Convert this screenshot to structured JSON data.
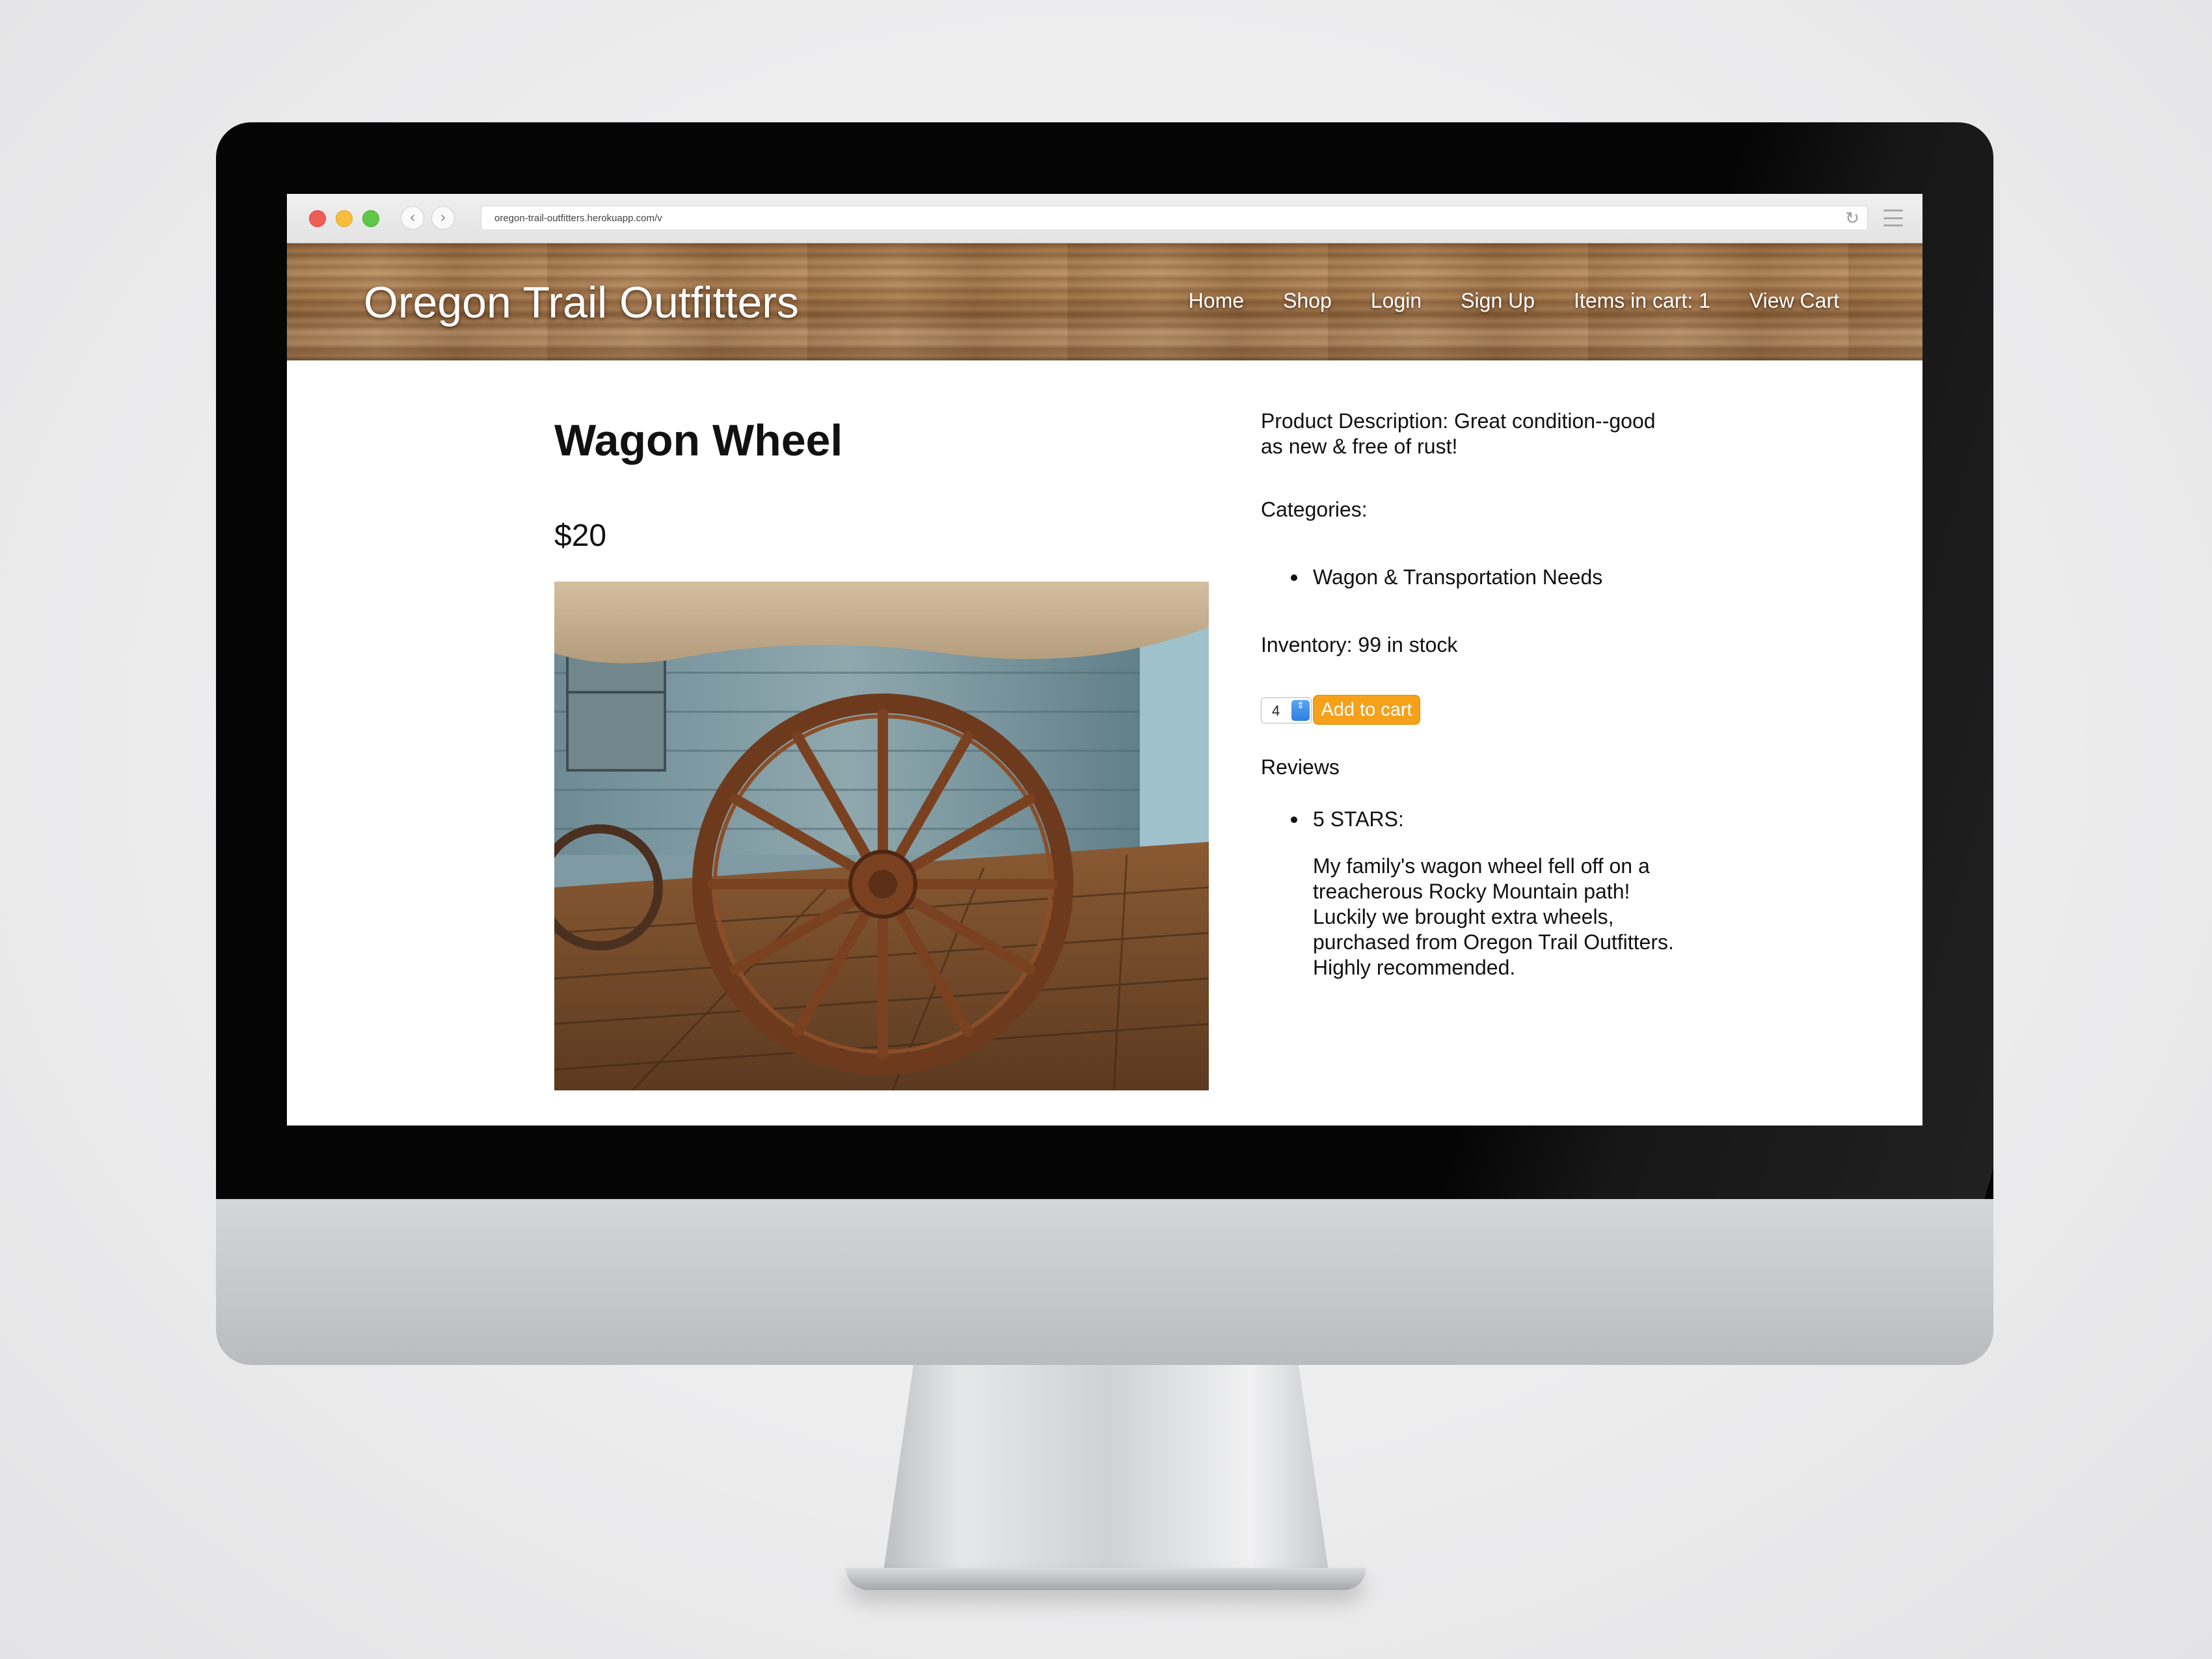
{
  "browser": {
    "url": "oregon-trail-outfitters.herokuapp.com/v",
    "back_icon": "‹",
    "forward_icon": "›",
    "reload_icon": "↻"
  },
  "site": {
    "title": "Oregon Trail Outfitters",
    "nav": {
      "home": "Home",
      "shop": "Shop",
      "login": "Login",
      "signup": "Sign Up",
      "cart_count": "Items in cart: 1",
      "view_cart": "View Cart"
    }
  },
  "product": {
    "name": "Wagon Wheel",
    "price": "$20",
    "description": "Product Description: Great condition--good as new & free of rust!",
    "categories_label": "Categories:",
    "categories": [
      "Wagon & Transportation Needs"
    ],
    "inventory": "Inventory: 99 in stock",
    "quantity": "4",
    "add_to_cart_label": "Add to cart",
    "reviews_label": "Reviews",
    "reviews": [
      {
        "rating": "5 STARS:",
        "text": "My family's wagon wheel fell off on a treacherous Rocky Mountain path! Luckily we brought extra wheels, purchased from Oregon Trail Outfitters. Highly recommended."
      }
    ]
  },
  "colors": {
    "accent_button": "#f5a11a",
    "stepper_blue": "#2d7ee0",
    "header_wood": "#a07247"
  },
  "icons": {
    "stepper": "⇕"
  }
}
